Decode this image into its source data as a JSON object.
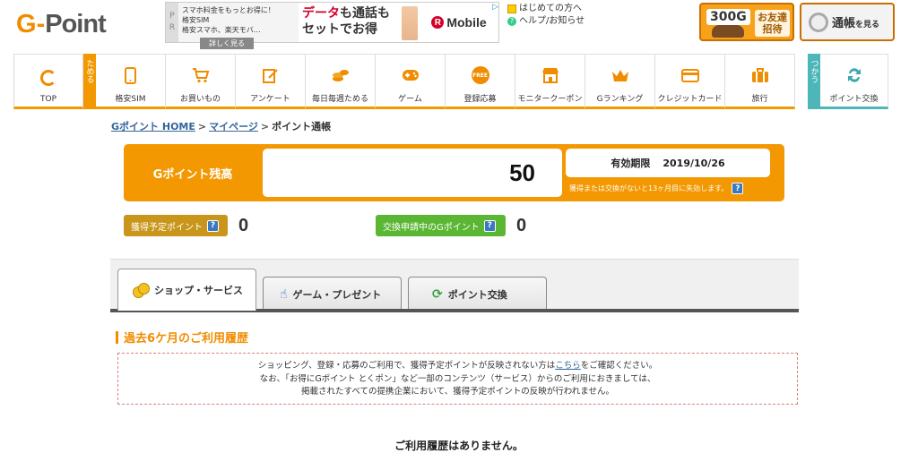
{
  "logo": {
    "text_g": "G",
    "text_dash": "-",
    "text_point": "Point"
  },
  "ad": {
    "pr_1": "P",
    "pr_2": "R",
    "left_line1": "スマホ料金をもっとお得に！",
    "left_line2": "格安SIM",
    "left_line3": "格安スマホ、楽天モバ…",
    "left_button": "詳しく見る",
    "mid_line1_red": "データ",
    "mid_line1_rest": "も通話も",
    "mid_line2": "セットでお得",
    "brand_icon": "R",
    "brand": "Mobile"
  },
  "help": {
    "first_time": "はじめての方へ",
    "help_news": "ヘルプ/お知らせ"
  },
  "banner_friend": {
    "amount": "300G",
    "line1": "お友達",
    "line2": "招待"
  },
  "banner_passbook": {
    "label_big": "通帳",
    "label_small": "を見る"
  },
  "nav": {
    "top": "TOP",
    "side_earn": "ためる",
    "items": [
      {
        "label": "格安SIM",
        "icon": "phone-icon"
      },
      {
        "label": "お買いもの",
        "icon": "cart-icon"
      },
      {
        "label": "アンケート",
        "icon": "survey-icon"
      },
      {
        "label": "毎日毎週ためる",
        "icon": "coins-icon"
      },
      {
        "label": "ゲーム",
        "icon": "gamepad-icon"
      },
      {
        "label": "登録応募",
        "icon": "free-icon"
      },
      {
        "label": "モニタークーポン",
        "icon": "shop-icon"
      },
      {
        "label": "Gランキング",
        "icon": "crown-icon"
      },
      {
        "label": "クレジットカード",
        "icon": "card-icon"
      },
      {
        "label": "旅行",
        "icon": "suitcase-icon"
      }
    ],
    "side_use": "つかう",
    "exchange": "ポイント交換",
    "free_icon_text": "FREE"
  },
  "breadcrumb": {
    "home": "Gポイント HOME",
    "mypage": "マイページ",
    "current": "ポイント通帳",
    "sep": ">"
  },
  "balance": {
    "label": "Gポイント残高",
    "value": "50",
    "expiry_label": "有効期限",
    "expiry_date": "2019/10/26",
    "expiry_note": "獲得または交換がないと13ヶ月目に失効します。"
  },
  "pending": {
    "label": "獲得予定ポイント",
    "value": "0"
  },
  "exchange_pending": {
    "label": "交換申請中のGポイント",
    "value": "0"
  },
  "help_q": "?",
  "tabs": [
    {
      "label": "ショップ・サービス",
      "active": true
    },
    {
      "label": "ゲーム・プレゼント",
      "active": false
    },
    {
      "label": "ポイント交換",
      "active": false
    }
  ],
  "history": {
    "title": "過去6ケ月のご利用履歴",
    "notice_line1_a": "ショッピング、登録・応募のご利用で、獲得予定ポイントが反映されない方は",
    "notice_link": "こちら",
    "notice_line1_b": "をご確認ください。",
    "notice_line2": "なお、「お得にGポイント とくポン」など一部のコンテンツ（サービス）からのご利用におきましては、",
    "notice_line3": "掲載されたすべての提携企業において、獲得予定ポイントの反映が行われません。",
    "empty": "ご利用履歴はありません。"
  }
}
